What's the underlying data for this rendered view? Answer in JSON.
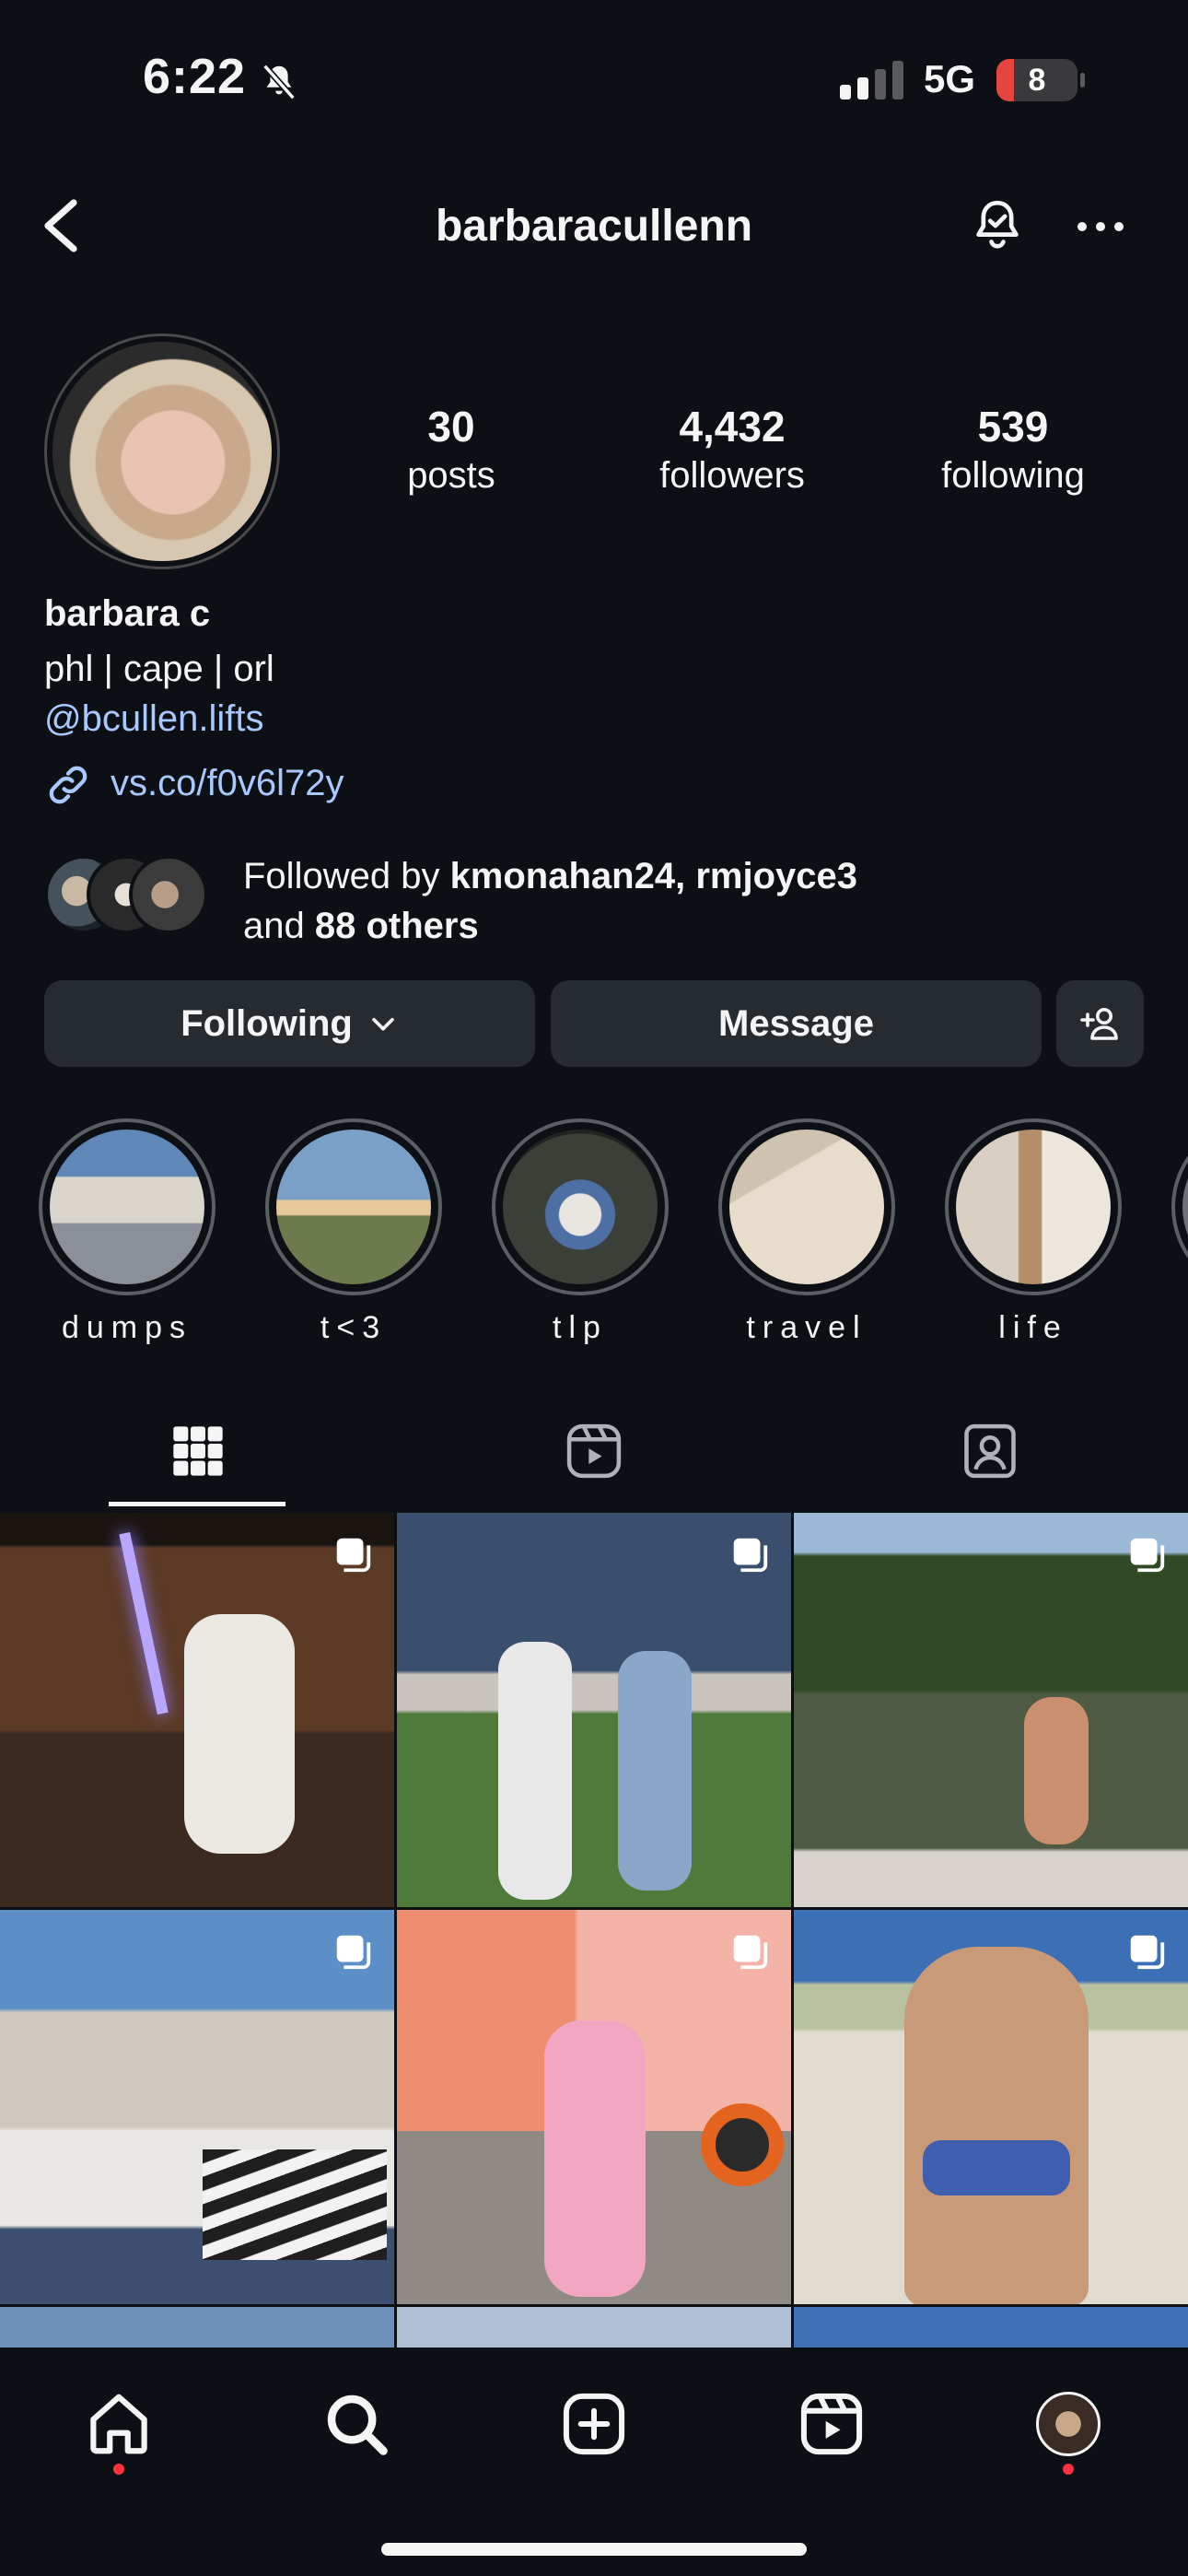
{
  "status_bar": {
    "time": "6:22",
    "network": "5G",
    "battery_level": "8",
    "battery_fraction": 0.08,
    "battery_color": "#e5453c"
  },
  "header": {
    "username": "barbaracullenn"
  },
  "profile": {
    "stats": [
      {
        "value": "30",
        "label": "posts"
      },
      {
        "value": "4,432",
        "label": "followers"
      },
      {
        "value": "539",
        "label": "following"
      }
    ],
    "display_name": "barbara c",
    "bio": "phl | cape | orl",
    "mention": "@bcullen.lifts",
    "link": "vs.co/f0v6l72y",
    "followed_by": {
      "prefix": "Followed by ",
      "users": "kmonahan24, rmjoyce3",
      "line2_prefix": "and ",
      "others": "88 others"
    }
  },
  "actions": {
    "following_label": "Following",
    "message_label": "Message"
  },
  "highlights": [
    {
      "label": "dumps"
    },
    {
      "label": "t<3"
    },
    {
      "label": "tlp"
    },
    {
      "label": "travel"
    },
    {
      "label": "life"
    }
  ],
  "tabs": [
    "grid-icon",
    "reels-icon",
    "tagged-icon"
  ],
  "colors": {
    "background": "#0c1014",
    "link": "#a8c9ff",
    "button": "#262b30",
    "notification_dot": "#ff3040"
  }
}
